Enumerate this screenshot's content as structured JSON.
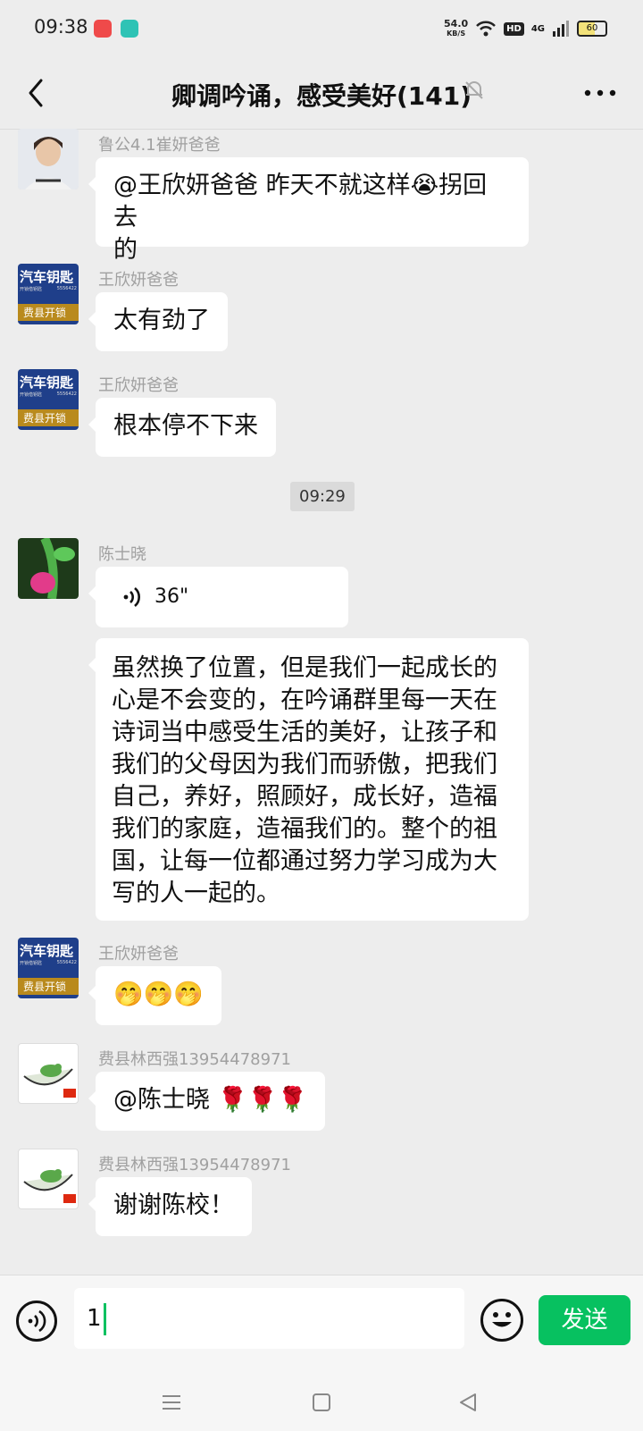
{
  "status_bar": {
    "time": "09:38",
    "net_speed_value": "54.0",
    "net_speed_unit": "KB/S",
    "hd": "HD",
    "signal_type": "4G",
    "battery": "60"
  },
  "header": {
    "title": "卿调吟诵，感受美好(141)"
  },
  "messages": [
    {
      "sender": "鲁公4.1崔妍爸爸",
      "text_1": "@王欣妍爸爸  昨天不就这样😭拐回去",
      "text_2": "的"
    },
    {
      "sender": "王欣妍爸爸",
      "text": "太有劲了"
    },
    {
      "sender": "王欣妍爸爸",
      "text": "根本停不下来"
    },
    {
      "timestamp": "09:29"
    },
    {
      "sender": "陈士晓",
      "voice_duration": "36\"",
      "text_lines": [
        "虽然换了位置，但是我们一起成长的",
        "心是不会变的，在吟诵群里每一天在",
        "诗词当中感受生活的美好，让孩子和",
        "我们的父母因为我们而骄傲，把我们",
        "自己，养好，照顾好，成长好，造福",
        "我们的家庭，造福我们的。整个的祖",
        "国，让每一位都通过努力学习成为大",
        "写的人一起的。"
      ]
    },
    {
      "sender": "王欣妍爸爸",
      "text": "🤭🤭🤭"
    },
    {
      "sender": "费县林西强13954478971",
      "text": "@陈士晓 🌹🌹🌹"
    },
    {
      "sender": "费县林西强13954478971",
      "text": "谢谢陈校！"
    }
  ],
  "avatar_texts": {
    "car_key_1": "汽车钥匙",
    "car_key_2": "费县开锁",
    "car_key_small": "开锁借钥匙",
    "car_key_phone": "5556422"
  },
  "composer": {
    "input_value": "1",
    "send_label": "发送"
  },
  "colors": {
    "accent": "#07c160",
    "background": "#ededed"
  }
}
